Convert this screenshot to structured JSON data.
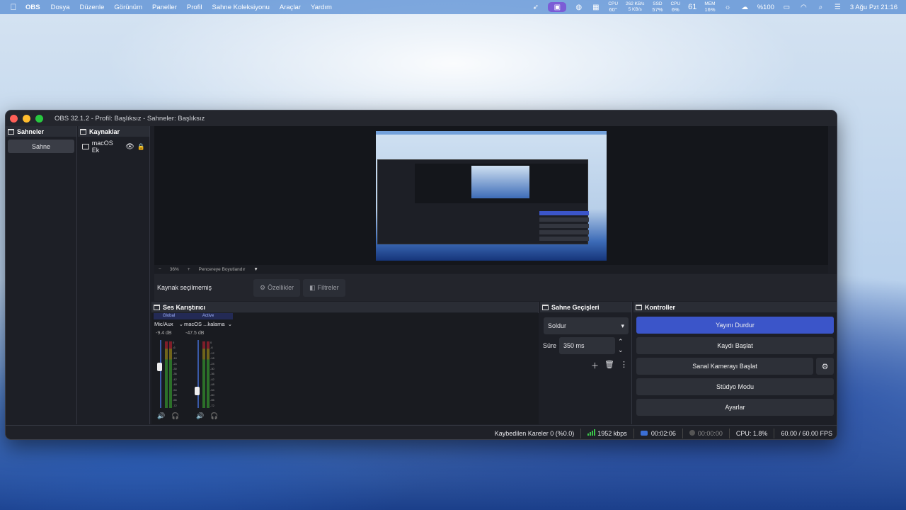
{
  "menubar": {
    "app": "OBS",
    "items": [
      "Dosya",
      "Düzenle",
      "Görünüm",
      "Paneller",
      "Profil",
      "Sahne Koleksiyonu",
      "Araçlar",
      "Yardım"
    ],
    "cpu_temp_label": "CPU",
    "cpu_temp": "60°",
    "net_up": "262 KB/s",
    "net_down": "5 KB/s",
    "ssd_label": "SSD",
    "ssd": "57%",
    "cpu_label": "CPU",
    "cpu": "6%",
    "temp": "61",
    "mem_label": "MEM",
    "mem": "16%",
    "battery": "%100",
    "clock": "3 Ağu Pzt  21:16"
  },
  "window": {
    "title": "OBS 32.1.2 - Profil: Başlıksız - Sahneler: Başlıksız"
  },
  "scenes": {
    "title": "Sahneler",
    "items": [
      "Sahne"
    ]
  },
  "sources": {
    "title": "Kaynaklar",
    "items": [
      "macOS Ek"
    ]
  },
  "zoombar": {
    "minus": "−",
    "zoom": "36%",
    "plus": "+",
    "fit": "Pencereye Boyutlandır",
    "arrow": "▼"
  },
  "sourcebar": {
    "no_selection": "Kaynak seçilmemiş",
    "properties": "Özellikler",
    "filters": "Filtreler"
  },
  "mixer": {
    "title": "Ses Karıştırıcı",
    "channels": [
      {
        "header": "Global",
        "name": "Mic/Aux",
        "db": "-9.4 dB",
        "fader": 0.62
      },
      {
        "header": "Active",
        "name": "macOS ...kalama",
        "db": "-47.5 dB",
        "fader": 0.22
      }
    ],
    "ticks": [
      "0",
      "-6",
      "-12",
      "-18",
      "-24",
      "-30",
      "-36",
      "-42",
      "-48",
      "-54",
      "-60",
      "-66",
      "-72"
    ]
  },
  "transitions": {
    "title": "Sahne Geçişleri",
    "selected": "Soldur",
    "duration_label": "Süre",
    "duration": "350 ms"
  },
  "controls": {
    "title": "Kontroller",
    "stop_stream": "Yayını Durdur",
    "start_record": "Kaydı Başlat",
    "virtual_cam": "Sanal Kamerayı Başlat",
    "studio_mode": "Stüdyo Modu",
    "settings": "Ayarlar"
  },
  "status": {
    "dropped": "Kaybedilen Kareler 0 (%0.0)",
    "bitrate": "1952 kbps",
    "stream_time": "00:02:06",
    "record_time": "00:00:00",
    "cpu": "CPU: 1.8%",
    "fps": "60.00 / 60.00 FPS"
  },
  "colors": {
    "accent": "#3b55c9",
    "bg": "#1d1f26",
    "good": "#3bc54a"
  }
}
